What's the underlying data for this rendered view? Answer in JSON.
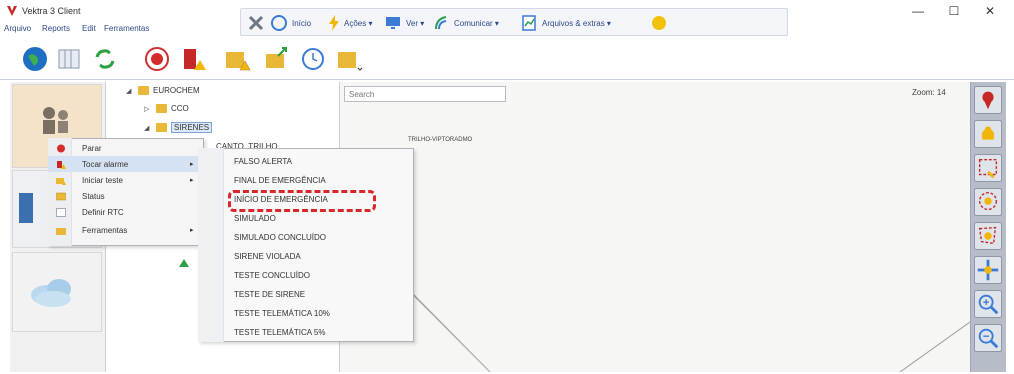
{
  "window": {
    "title": "Vektra 3 Client",
    "minimize": "—",
    "maximize": "☐",
    "close": "✕"
  },
  "menu": [
    "Arquivo",
    "Reports",
    "Edit",
    "Ferramentas"
  ],
  "quickbar": {
    "inicio": "Início",
    "acoes": "Ações ▾",
    "ver": "Ver ▾",
    "comunicar": "Comunicar ▾",
    "arquivos": "Arquivos & extras ▾"
  },
  "tree": {
    "root": "EUROCHEM",
    "child1": "CCO",
    "child2": "SIRENES",
    "child3": "CANTO_TRILHO"
  },
  "search": {
    "placeholder": "Search"
  },
  "map": {
    "zoom": "Zoom: 14",
    "caption": "TRILHO-VIPTORADMO"
  },
  "context_menu": [
    {
      "label": "Parar",
      "has_sub": false
    },
    {
      "label": "Tocar alarme",
      "has_sub": true
    },
    {
      "label": "Iniciar teste",
      "has_sub": true
    },
    {
      "label": "Status",
      "has_sub": false
    },
    {
      "label": "Definir RTC",
      "has_sub": false
    },
    {
      "label": "Ferramentas",
      "has_sub": true
    }
  ],
  "submenu": [
    "FALSO ALERTA",
    "FINAL DE EMERGÊNCIA",
    "INÍCIO DE EMERGÊNCIA",
    "SIMULADO",
    "SIMULADO CONCLUÍDO",
    "SIRENE VIOLADA",
    "TESTE CONCLUÍDO",
    "TESTE DE SIRENE",
    "TESTE TELEMÁTICA 10%",
    "TESTE TELEMÁTICA 5%"
  ],
  "colors": {
    "highlight": "#d8262b",
    "menu_text": "#2c4a8a"
  }
}
